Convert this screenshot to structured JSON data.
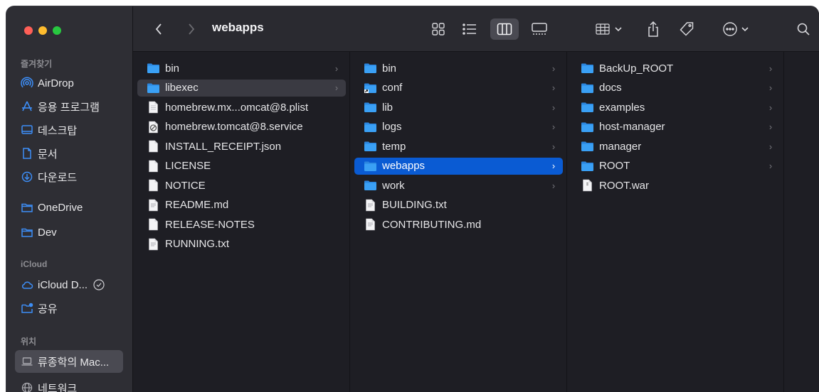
{
  "window": {
    "title": "webapps"
  },
  "sidebar": {
    "favorites_label": "즐겨찾기",
    "favorites": [
      {
        "label": "AirDrop",
        "icon": "airdrop-icon"
      },
      {
        "label": "응용 프로그램",
        "icon": "applications-icon"
      },
      {
        "label": "데스크탑",
        "icon": "desktop-icon"
      },
      {
        "label": "문서",
        "icon": "document-icon"
      },
      {
        "label": "다운로드",
        "icon": "download-icon"
      },
      {
        "label": "OneDrive",
        "icon": "folder-icon"
      },
      {
        "label": "Dev",
        "icon": "folder-icon"
      }
    ],
    "icloud_label": "iCloud",
    "icloud": [
      {
        "label": "iCloud D...",
        "icon": "cloud-icon"
      },
      {
        "label": "공유",
        "icon": "shared-folder-icon"
      }
    ],
    "locations_label": "위치",
    "locations": [
      {
        "label": "류종학의 Mac...",
        "icon": "laptop-icon",
        "active": true
      },
      {
        "label": "네트워크",
        "icon": "network-icon"
      }
    ]
  },
  "columns": [
    {
      "items": [
        {
          "name": "bin",
          "type": "folder",
          "chevron": true
        },
        {
          "name": "libexec",
          "type": "folder",
          "chevron": true,
          "state": "hover"
        },
        {
          "name": "homebrew.mx...omcat@8.plist",
          "type": "plist"
        },
        {
          "name": "homebrew.tomcat@8.service",
          "type": "service"
        },
        {
          "name": "INSTALL_RECEIPT.json",
          "type": "file"
        },
        {
          "name": "LICENSE",
          "type": "file"
        },
        {
          "name": "NOTICE",
          "type": "file"
        },
        {
          "name": "README.md",
          "type": "md"
        },
        {
          "name": "RELEASE-NOTES",
          "type": "file"
        },
        {
          "name": "RUNNING.txt",
          "type": "txt"
        }
      ]
    },
    {
      "items": [
        {
          "name": "bin",
          "type": "folder",
          "chevron": true
        },
        {
          "name": "conf",
          "type": "folder-alias",
          "chevron": true
        },
        {
          "name": "lib",
          "type": "folder",
          "chevron": true
        },
        {
          "name": "logs",
          "type": "folder",
          "chevron": true
        },
        {
          "name": "temp",
          "type": "folder",
          "chevron": true
        },
        {
          "name": "webapps",
          "type": "folder",
          "chevron": true,
          "state": "selected"
        },
        {
          "name": "work",
          "type": "folder",
          "chevron": true
        },
        {
          "name": "BUILDING.txt",
          "type": "txt"
        },
        {
          "name": "CONTRIBUTING.md",
          "type": "md"
        }
      ]
    },
    {
      "items": [
        {
          "name": "BackUp_ROOT",
          "type": "folder",
          "chevron": true
        },
        {
          "name": "docs",
          "type": "folder",
          "chevron": true
        },
        {
          "name": "examples",
          "type": "folder",
          "chevron": true
        },
        {
          "name": "host-manager",
          "type": "folder",
          "chevron": true
        },
        {
          "name": "manager",
          "type": "folder",
          "chevron": true
        },
        {
          "name": "ROOT",
          "type": "folder",
          "chevron": true
        },
        {
          "name": "ROOT.war",
          "type": "war"
        }
      ]
    },
    {
      "items": []
    }
  ],
  "colors": {
    "accent": "#0a5bd3",
    "folder": "#3aa0f5",
    "sidebar_icon": "#3d8ef7"
  }
}
